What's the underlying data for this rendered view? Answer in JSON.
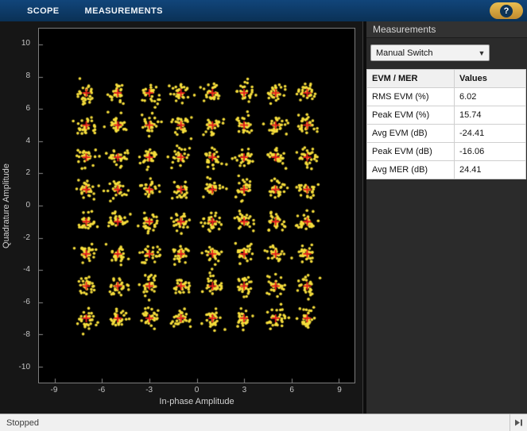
{
  "toolbar": {
    "tabs": [
      {
        "label": "SCOPE"
      },
      {
        "label": "MEASUREMENTS"
      }
    ],
    "help_label": "?"
  },
  "chart_data": {
    "type": "scatter",
    "description": "64-QAM constellation diagram: received symbols (yellow dots) scattered around reference constellation points (red plus markers)",
    "xlabel": "In-phase Amplitude",
    "ylabel": "Quadrature Amplitude",
    "xlim": [
      -10,
      10
    ],
    "ylim": [
      -11,
      11
    ],
    "x_ticks": [
      -9,
      -6,
      -3,
      0,
      3,
      6,
      9
    ],
    "y_ticks": [
      -10,
      -8,
      -6,
      -4,
      -2,
      0,
      2,
      4,
      6,
      8,
      10
    ],
    "grid": false,
    "legend": false,
    "cluster_levels": [
      -7,
      -5,
      -3,
      -1,
      1,
      3,
      5,
      7
    ],
    "points_per_cluster": 30,
    "noise_sigma": 0.3,
    "series": [
      {
        "name": "Received symbols",
        "marker": "dot",
        "color": "#f7df3c"
      },
      {
        "name": "Reference constellation",
        "marker": "plus",
        "color": "#e81c1c"
      }
    ]
  },
  "measurements_panel": {
    "title": "Measurements",
    "dropdown_value": "Manual Switch",
    "table": {
      "headers": [
        "EVM / MER",
        "Values"
      ],
      "rows": [
        [
          "RMS EVM (%)",
          "6.02"
        ],
        [
          "Peak EVM (%)",
          "15.74"
        ],
        [
          "Avg EVM (dB)",
          "-24.41"
        ],
        [
          "Peak EVM (dB)",
          "-16.06"
        ],
        [
          "Avg MER (dB)",
          "24.41"
        ]
      ]
    }
  },
  "status_bar": {
    "text": "Stopped"
  }
}
